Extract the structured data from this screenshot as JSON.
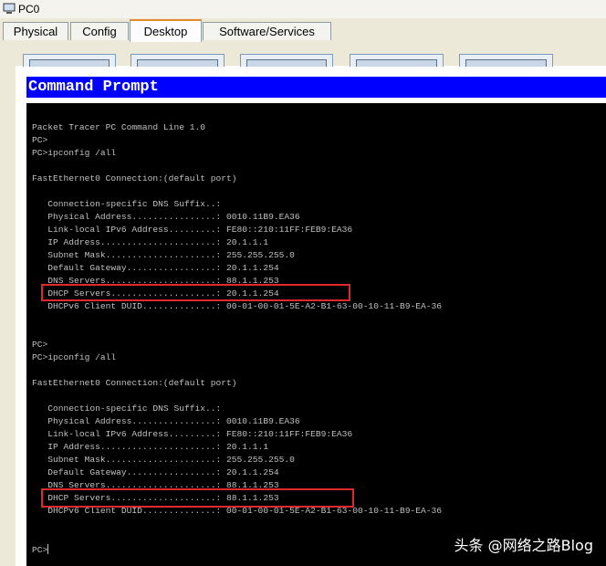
{
  "window": {
    "title": "PC0",
    "icon": "pc-icon"
  },
  "tabs": [
    {
      "label": "Physical"
    },
    {
      "label": "Config"
    },
    {
      "label": "Desktop",
      "active": true
    },
    {
      "label": "Software/Services"
    }
  ],
  "command_prompt": {
    "header": "Command Prompt",
    "lines": [
      "Packet Tracer PC Command Line 1.0",
      "PC>",
      "PC>ipconfig /all",
      "",
      "FastEthernet0 Connection:(default port)",
      "",
      "   Connection-specific DNS Suffix..:",
      "   Physical Address................: 0010.11B9.EA36",
      "   Link-local IPv6 Address.........: FE80::210:11FF:FEB9:EA36",
      "   IP Address......................: 20.1.1.1",
      "   Subnet Mask.....................: 255.255.255.0",
      "   Default Gateway.................: 20.1.1.254",
      "   DNS Servers.....................: 88.1.1.253",
      "   DHCP Servers....................: 20.1.1.254",
      "   DHCPv6 Client DUID..............: 00-01-00-01-5E-A2-B1-63-00-10-11-B9-EA-36",
      "",
      "",
      "PC>",
      "PC>ipconfig /all",
      "",
      "FastEthernet0 Connection:(default port)",
      "",
      "   Connection-specific DNS Suffix..:",
      "   Physical Address................: 0010.11B9.EA36",
      "   Link-local IPv6 Address.........: FE80::210:11FF:FEB9:EA36",
      "   IP Address......................: 20.1.1.1",
      "   Subnet Mask.....................: 255.255.255.0",
      "   Default Gateway.................: 20.1.1.254",
      "   DNS Servers.....................: 88.1.1.253",
      "   DHCP Servers....................: 88.1.1.253",
      "   DHCPv6 Client DUID..............: 00-01-00-01-5E-A2-B1-63-00-10-11-B9-EA-36",
      "",
      "",
      "PC>"
    ]
  },
  "annotation": {
    "highlight_color": "#e0282f"
  },
  "watermark": {
    "text": "头条 @网络之路Blog"
  },
  "colors": {
    "header_bg": "#0000ff",
    "terminal_bg": "#000000",
    "terminal_text": "#c0c0c0",
    "active_tab_accent": "#e68b2c"
  }
}
